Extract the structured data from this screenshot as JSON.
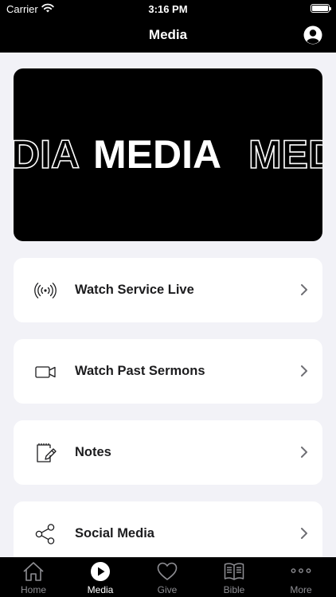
{
  "status_bar": {
    "carrier": "Carrier",
    "time": "3:16 PM"
  },
  "header": {
    "title": "Media"
  },
  "banner": {
    "left_text": "DIA",
    "center_text": "MEDIA",
    "right_text": "MED"
  },
  "menu": [
    {
      "label": "Watch Service Live",
      "icon": "broadcast-icon"
    },
    {
      "label": "Watch Past Sermons",
      "icon": "video-camera-icon"
    },
    {
      "label": "Notes",
      "icon": "notepad-icon"
    },
    {
      "label": "Social Media",
      "icon": "share-icon"
    }
  ],
  "tabs": [
    {
      "label": "Home",
      "icon": "home-icon",
      "active": false
    },
    {
      "label": "Media",
      "icon": "play-icon",
      "active": true
    },
    {
      "label": "Give",
      "icon": "heart-icon",
      "active": false
    },
    {
      "label": "Bible",
      "icon": "book-icon",
      "active": false
    },
    {
      "label": "More",
      "icon": "more-icon",
      "active": false
    }
  ],
  "colors": {
    "background": "#f2f2f7",
    "bars": "#000000",
    "card": "#ffffff",
    "text": "#1c1c1e",
    "inactive_tab": "#8e8e93"
  }
}
